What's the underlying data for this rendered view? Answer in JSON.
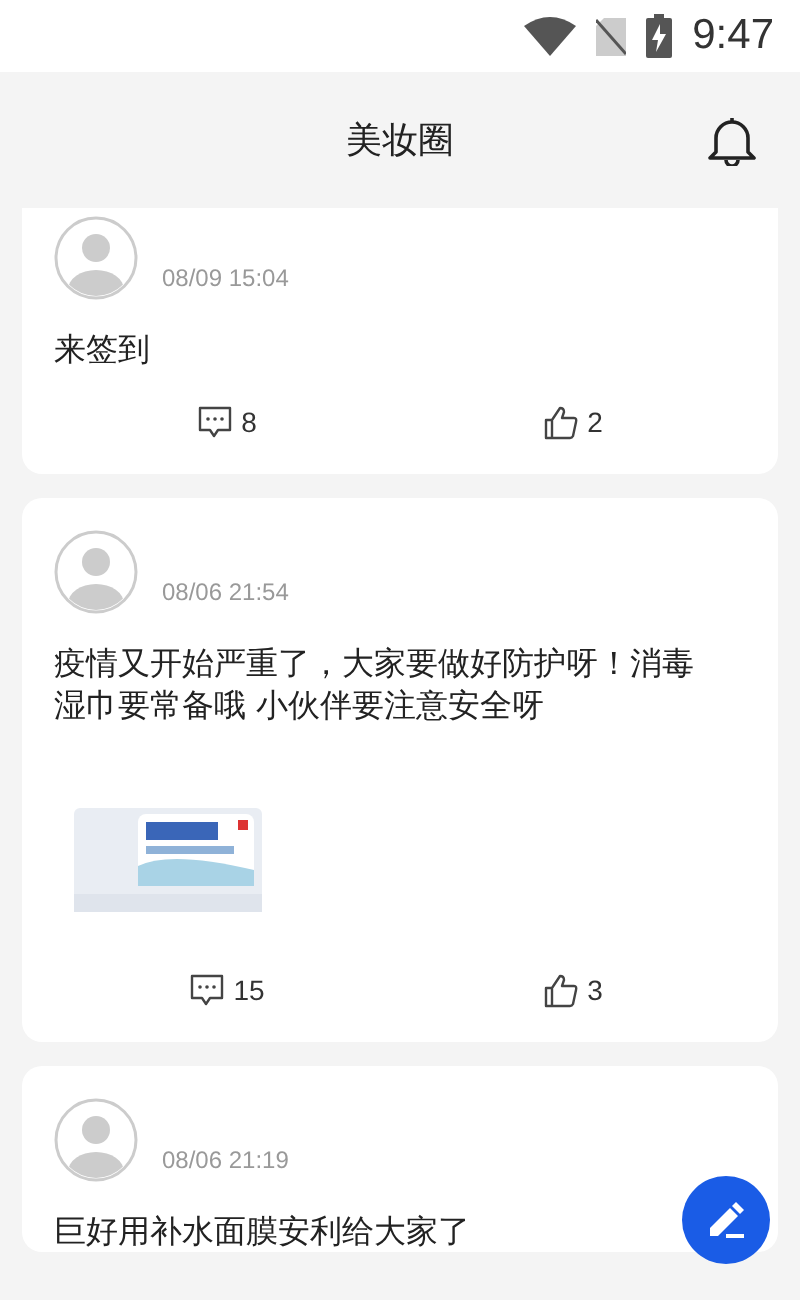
{
  "status_bar": {
    "time": "9:47"
  },
  "header": {
    "title": "美妆圈"
  },
  "posts": [
    {
      "time": "08/09 15:04",
      "text": "来签到",
      "comments": "8",
      "likes": "2"
    },
    {
      "time": "08/06 21:54",
      "text": "疫情又开始严重了，大家要做好防护呀！消毒湿巾要常备哦 小伙伴要注意安全呀",
      "comments": "15",
      "likes": "3"
    },
    {
      "time": "08/06 21:19",
      "text": "巨好用补水面膜安利给大家了"
    }
  ]
}
